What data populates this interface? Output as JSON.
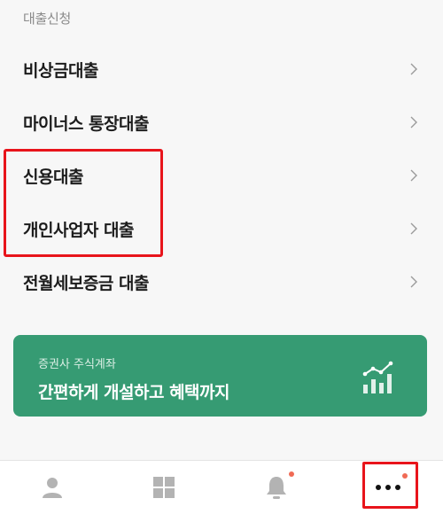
{
  "section_title": "대출신청",
  "menu_items": [
    {
      "label": "비상금대출",
      "icon": "chevron-right-icon"
    },
    {
      "label": "마이너스 통장대출",
      "icon": "chevron-right-icon"
    },
    {
      "label": "신용대출",
      "icon": "chevron-right-icon"
    },
    {
      "label": "개인사업자 대출",
      "icon": "chevron-right-icon"
    },
    {
      "label": "전월세보증금 대출",
      "icon": "chevron-right-icon"
    }
  ],
  "promo": {
    "subtitle": "증권사 주식계좌",
    "title": "간편하게 개설하고 혜택까지",
    "icon": "stock-chart-icon",
    "color": "#369b73"
  },
  "bottom_nav": [
    {
      "icon": "person-icon",
      "notification": false
    },
    {
      "icon": "grid-icon",
      "notification": false
    },
    {
      "icon": "bell-icon",
      "notification": true
    },
    {
      "icon": "more-icon",
      "notification": true
    }
  ],
  "colors": {
    "highlight": "#e8141b",
    "notification_dot": "#f06a55",
    "nav_icon": "#b3b3b3"
  }
}
